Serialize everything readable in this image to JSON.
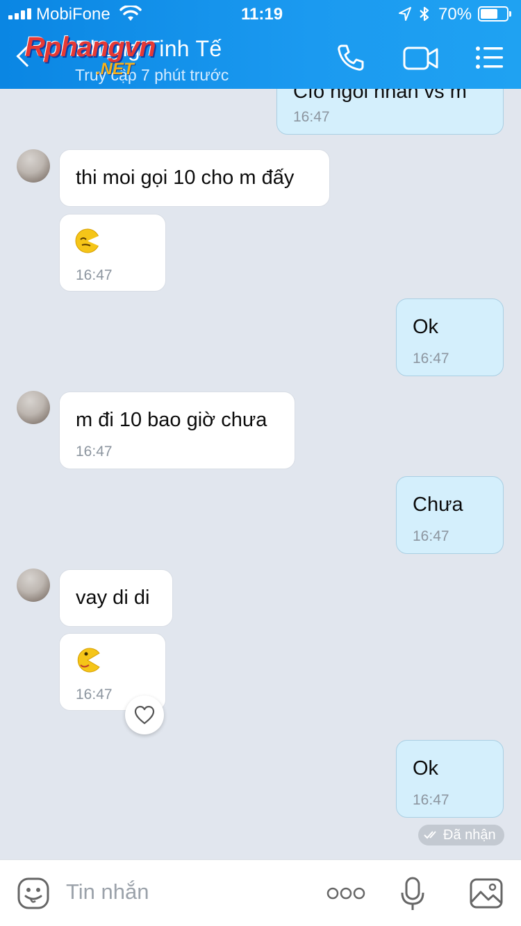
{
  "status_bar": {
    "carrier": "MobiFone",
    "time": "11:19",
    "battery": "70%",
    "battery_level": 0.7
  },
  "header": {
    "title": "Phong Tinh Tế",
    "subtitle": "Truy cập 7 phút trước",
    "watermark": "Rphangvn",
    "watermark_sub": ".NET",
    "icons": [
      "back-arrow-icon",
      "phone-icon",
      "video-camera-icon",
      "menu-list-icon"
    ]
  },
  "messages": [
    {
      "side": "out",
      "text": "Cfo ngoi nhan vs m",
      "time": "16:47"
    },
    {
      "side": "in",
      "text": "thi moi gọi 10 cho m đấy",
      "time": ""
    },
    {
      "side": "in",
      "sticker": "sleepy-emoji-icon",
      "time": "16:47"
    },
    {
      "side": "out",
      "text": "Ok",
      "time": "16:47"
    },
    {
      "side": "in",
      "text": "m đi 10 bao giờ chưa",
      "time": "16:47"
    },
    {
      "side": "out",
      "text": "Chưa",
      "time": "16:47"
    },
    {
      "side": "in",
      "text": "vay di di",
      "time": ""
    },
    {
      "side": "in",
      "sticker": "pacman-emoji-icon",
      "time": "16:47"
    },
    {
      "side": "out",
      "text": "Ok",
      "time": "16:47"
    }
  ],
  "received_label": "Đã nhận",
  "input": {
    "placeholder": "Tin nhắn",
    "icons": [
      "emoji-icon",
      "more-dots-icon",
      "microphone-icon",
      "image-icon"
    ]
  },
  "colors": {
    "header": "#1b9af0",
    "background": "#e1e6ee",
    "incoming_bubble": "#ffffff",
    "outgoing_bubble": "#d4effc"
  }
}
